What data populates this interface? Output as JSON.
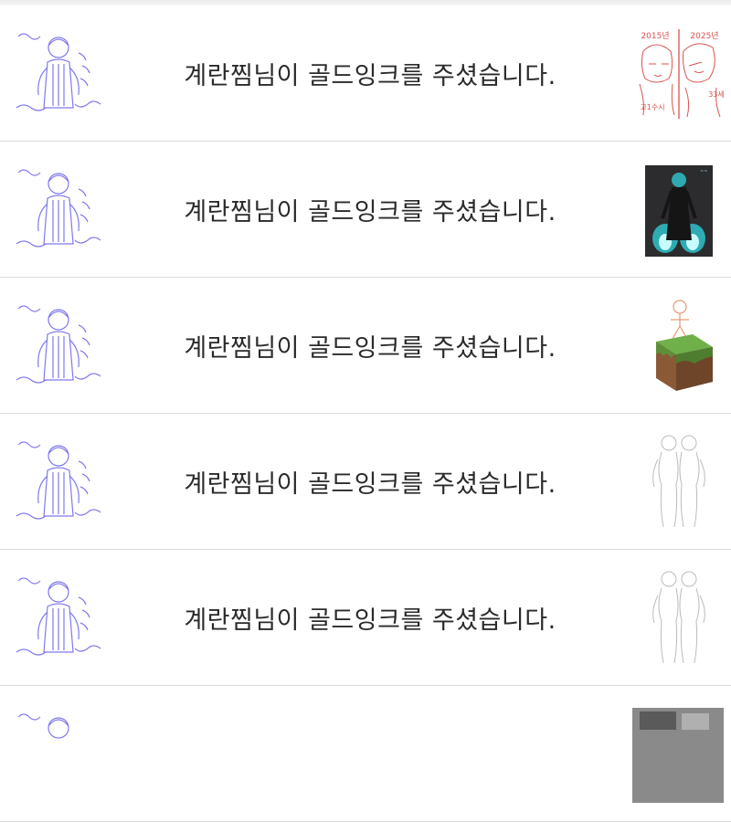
{
  "notifications": [
    {
      "message": "계란찜님이 골드잉크를 주셨습니다.",
      "avatar_icon": "sketch-portrait",
      "thumbnail": {
        "icon": "then-and-now-drawing",
        "labels": [
          "2015년",
          "2025년",
          "고1수시",
          "33세"
        ],
        "color": "#d9534f"
      }
    },
    {
      "message": "계란찜님이 골드잉크를 주셨습니다.",
      "avatar_icon": "sketch-portrait",
      "thumbnail": {
        "icon": "blue-flame-character",
        "labels": [],
        "color": "#2fd6e0"
      }
    },
    {
      "message": "계란찜님이 골드잉크를 주셨습니다.",
      "avatar_icon": "sketch-portrait",
      "thumbnail": {
        "icon": "grass-block-figure",
        "labels": [],
        "color": "#5d8f3a"
      }
    },
    {
      "message": "계란찜님이 골드잉크를 주셨습니다.",
      "avatar_icon": "sketch-portrait",
      "thumbnail": {
        "icon": "back-to-back-line-sketch",
        "labels": [],
        "color": "#bbbbbb"
      }
    },
    {
      "message": "계란찜님이 골드잉크를 주셨습니다.",
      "avatar_icon": "sketch-portrait",
      "thumbnail": {
        "icon": "back-to-back-line-sketch",
        "labels": [],
        "color": "#bbbbbb"
      }
    },
    {
      "message": "",
      "avatar_icon": "sketch-portrait",
      "thumbnail": {
        "icon": "photo-thumbnail",
        "labels": [],
        "color": "#6a6a6a"
      }
    }
  ],
  "colors": {
    "avatar_sketch": "#6b63e8",
    "divider": "#dcdcdc",
    "text": "#2b2b2b"
  }
}
